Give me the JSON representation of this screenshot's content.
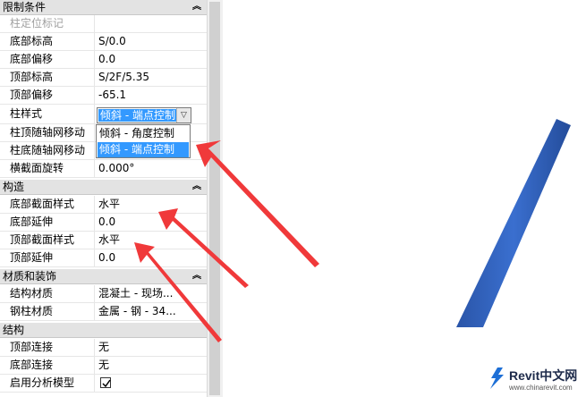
{
  "sections": [
    {
      "title": "限制条件",
      "collapse_icon": "double-chevron-up"
    },
    {
      "title": "构造",
      "collapse_icon": "double-chevron-up"
    },
    {
      "title": "材质和装饰",
      "collapse_icon": "double-chevron-up"
    },
    {
      "title": "结构",
      "collapse_icon": "double-chevron-up"
    }
  ],
  "constraints": [
    {
      "label": "柱定位标记",
      "value": ""
    },
    {
      "label": "底部标高",
      "value": "S/0.0"
    },
    {
      "label": "底部偏移",
      "value": "0.0"
    },
    {
      "label": "顶部标高",
      "value": "S/2F/5.35"
    },
    {
      "label": "顶部偏移",
      "value": "-65.1"
    },
    {
      "label": "柱样式",
      "value": "倾斜 - 端点控制"
    },
    {
      "label": "柱顶随轴网移动",
      "value": ""
    },
    {
      "label": "柱底随轴网移动",
      "value": ""
    },
    {
      "label": "横截面旋转",
      "value": "0.000°"
    }
  ],
  "construction": [
    {
      "label": "底部截面样式",
      "value": "水平"
    },
    {
      "label": "底部延伸",
      "value": "0.0"
    },
    {
      "label": "顶部截面样式",
      "value": "水平"
    },
    {
      "label": "顶部延伸",
      "value": "0.0"
    }
  ],
  "materials": [
    {
      "label": "结构材质",
      "value": "混凝土 - 现场..."
    },
    {
      "label": "钢柱材质",
      "value": "金属 - 钢 - 34..."
    }
  ],
  "structure": [
    {
      "label": "顶部连接",
      "value": "无"
    },
    {
      "label": "底部连接",
      "value": "无"
    },
    {
      "label": "启用分析模型",
      "value": "",
      "checked": true
    }
  ],
  "dropdown": {
    "selected": "倾斜 - 端点控制",
    "options": [
      "倾斜 - 角度控制",
      "倾斜 - 端点控制"
    ],
    "selected_index": 1
  },
  "watermark": {
    "brand": "Revit中文网",
    "url": "www.chinarevit.com"
  },
  "colors": {
    "column": "#2e5fb8",
    "arrow": "#f0393a",
    "selection": "#3399ff"
  }
}
